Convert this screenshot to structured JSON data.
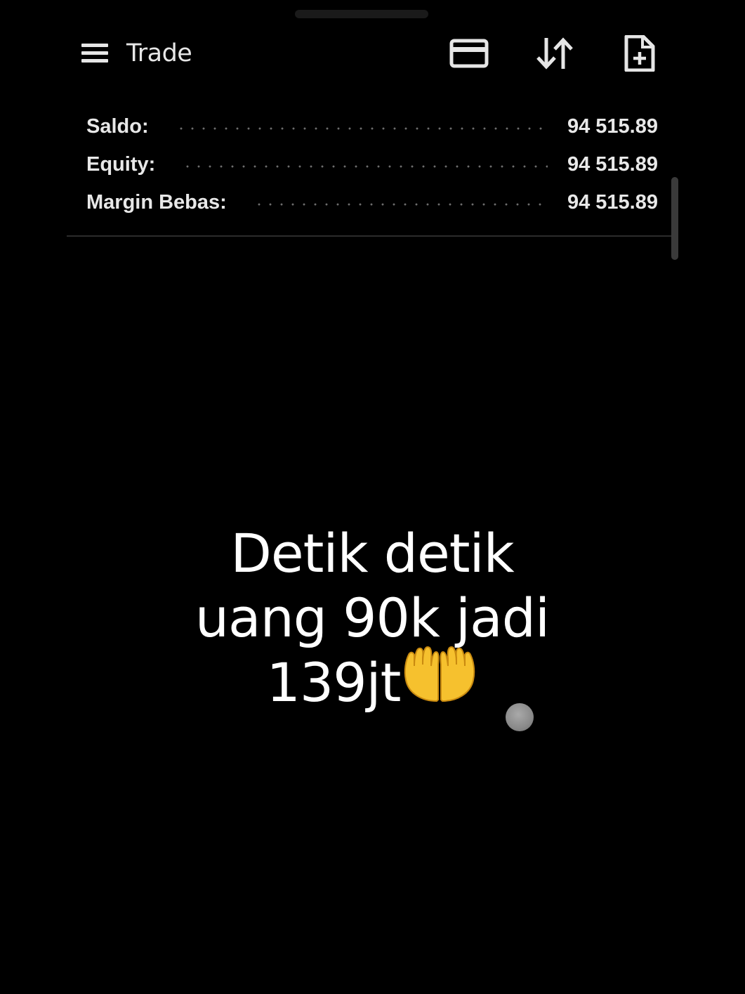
{
  "toolbar": {
    "title": "Trade",
    "icons": [
      "menu-icon",
      "credit-card-icon",
      "sort-arrows-icon",
      "new-document-icon"
    ]
  },
  "summary": [
    {
      "label": "Saldo:",
      "value": "94 515.89"
    },
    {
      "label": "Equity:",
      "value": "94 515.89"
    },
    {
      "label": "Margin Bebas:",
      "value": "94 515.89"
    }
  ],
  "caption": {
    "line1": "Detik detik",
    "line2": "uang 90k jadi",
    "line3": "139jt",
    "emoji_icon": "palms-up-together-icon"
  },
  "colors": {
    "background": "#000000",
    "text": "#e6e6e6",
    "emoji": "#f6c12e"
  }
}
